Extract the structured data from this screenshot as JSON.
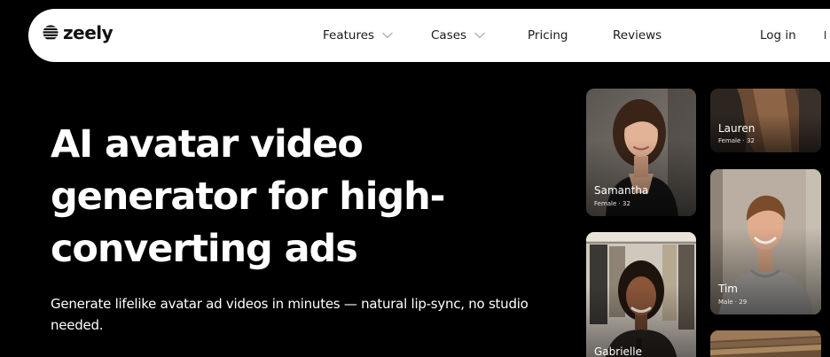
{
  "brand": {
    "name": "zeely",
    "logo_icon": "striped-globe-logo-icon"
  },
  "nav": {
    "items": [
      {
        "label": "Features",
        "has_dropdown": true,
        "icon": "chevron-down-icon"
      },
      {
        "label": "Cases",
        "has_dropdown": true,
        "icon": "chevron-down-icon"
      },
      {
        "label": "Pricing",
        "has_dropdown": false
      },
      {
        "label": "Reviews",
        "has_dropdown": false
      }
    ],
    "login_label": "Log in"
  },
  "hero": {
    "title": "AI avatar video generator for high-converting ads",
    "subtitle": "Generate lifelike avatar ad videos in minutes — natural lip-sync, no studio needed."
  },
  "avatars": [
    {
      "name": "Samantha",
      "meta": "Female · 32"
    },
    {
      "name": "Lauren",
      "meta": "Female · 32"
    },
    {
      "name": "Gabrielle",
      "meta": ""
    },
    {
      "name": "Tim",
      "meta": "Male · 29"
    },
    {
      "name": "",
      "meta": ""
    }
  ],
  "colors": {
    "background": "#000000",
    "navbar": "#ffffff",
    "nav_text": "#1a1a1a",
    "chevron": "#b5b5b5",
    "hero_text": "#ffffff"
  }
}
